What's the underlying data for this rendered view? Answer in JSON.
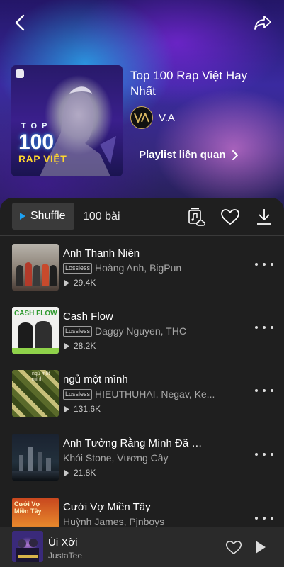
{
  "playlist": {
    "title": "Top 100 Rap Việt Hay Nhất",
    "artist": "V.A",
    "related_label": "Playlist liên quan",
    "cover": {
      "top_text": "TOP",
      "number_text": "100",
      "rap_text": "RAP VIỆT"
    }
  },
  "actions": {
    "shuffle_label": "Shuffle",
    "count_label": "100 bài"
  },
  "songs": [
    {
      "title": "Anh Thanh Niên",
      "artists": "Hoàng Anh, BigPun",
      "lossless": "Lossless",
      "plays": "29.4K"
    },
    {
      "title": "Cash Flow",
      "artists": "Daggy Nguyen, THC",
      "lossless": "Lossless",
      "plays": "28.2K",
      "thumb_text": "CASH FLOW"
    },
    {
      "title": "ngủ một mình",
      "artists": "HIEUTHUHAI, Negav, Ke...",
      "lossless": "Lossless",
      "plays": "131.6K",
      "thumb_text": "ngủ một mình"
    },
    {
      "title": "Anh Tưởng Rằng Mình Đã Q...",
      "artists": "Khói Stone, Vương Cây",
      "lossless": "",
      "plays": "21.8K"
    },
    {
      "title": "Cưới Vợ Miền Tây",
      "artists": "Huỳnh James, Pjnboys",
      "lossless": "",
      "plays": "",
      "thumb_text": "Cưới Vợ Miền Tây"
    }
  ],
  "player": {
    "title": "Úi Xời",
    "artist": "JustaTee"
  },
  "colors": {
    "background": "#1f1f1f",
    "accent_play": "#1da1f2",
    "hero_purple": "#3a2aa0"
  },
  "icons": [
    "back-arrow-icon",
    "share-icon",
    "play-triangle-icon",
    "cloud-music-icon",
    "heart-icon",
    "download-icon",
    "more-dots-icon",
    "play-icon"
  ]
}
